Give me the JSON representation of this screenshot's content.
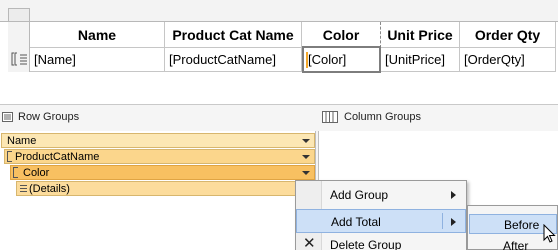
{
  "tablix": {
    "headers": [
      "Name",
      "Product Cat Name",
      "Color",
      "Unit Price",
      "Order Qty"
    ],
    "cells": [
      "[Name]",
      "[ProductCatName]",
      "[Color]",
      "[UnitPrice]",
      "[OrderQty]"
    ]
  },
  "grouping": {
    "row_groups_title": "Row Groups",
    "column_groups_title": "Column Groups",
    "row_groups": [
      "Name",
      "ProductCatName",
      "Color",
      "(Details)"
    ]
  },
  "context_menu": {
    "items": [
      "Add Group",
      "Add Total",
      "Delete Group"
    ],
    "submenu": [
      "Before",
      "After"
    ]
  },
  "colors": {
    "group_level_1": "#fce7b4",
    "group_level_2": "#fbd68c",
    "group_level_3": "#f8c061",
    "menu_highlight": "#cde0f7",
    "menu_highlight_border": "#8fb2e0",
    "caret": "#f4a82b"
  },
  "icons": {
    "row_groups": "row-groups-icon",
    "column_groups": "column-groups-icon",
    "delete": "delete-x-icon",
    "cursor": "mouse-pointer-icon"
  }
}
